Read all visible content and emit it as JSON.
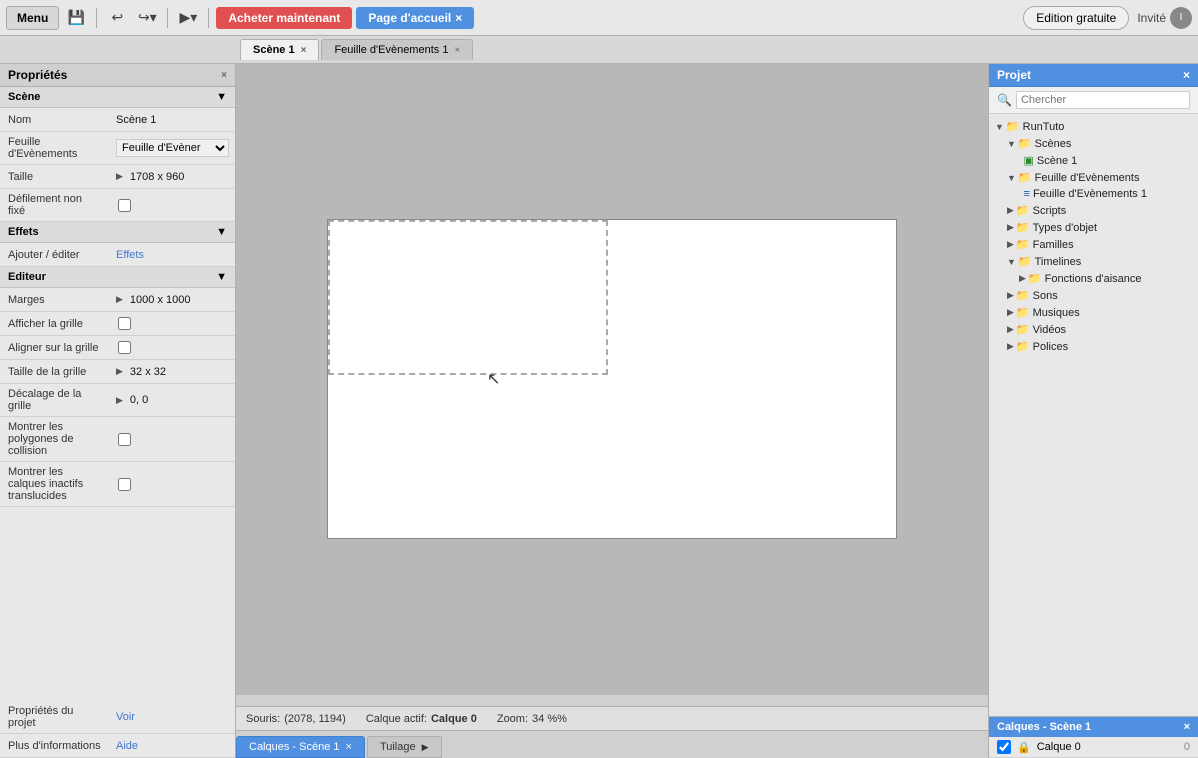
{
  "toolbar": {
    "menu_label": "Menu",
    "save_icon": "💾",
    "undo_icon": "↩",
    "redo_icon": "↪",
    "play_icon": "▶",
    "acheter_label": "Acheter maintenant",
    "accueil_label": "Page d'accueil",
    "accueil_close": "×",
    "edition_label": "Edition gratuite",
    "invite_label": "Invité",
    "avatar_label": "I"
  },
  "tabs": [
    {
      "label": "Scène 1",
      "active": true
    },
    {
      "label": "Feuille d'Evènements 1",
      "active": false
    }
  ],
  "properties": {
    "header": "Propriétés",
    "scene_section": "Scène",
    "rows": [
      {
        "label": "Nom",
        "value": "Scène 1",
        "type": "text"
      },
      {
        "label": "Feuille d'Evènements",
        "value": "Feuille d'Evèner",
        "type": "select"
      },
      {
        "label": "Taille",
        "value": "1708 x 960",
        "type": "arrow"
      },
      {
        "label": "Défilement non fixé",
        "value": "",
        "type": "checkbox"
      }
    ],
    "effects_section": "Effets",
    "effects_rows": [
      {
        "label": "Ajouter / éditer",
        "value": "Effets",
        "type": "link"
      }
    ],
    "editor_section": "Editeur",
    "editor_rows": [
      {
        "label": "Marges",
        "value": "1000 x 1000",
        "type": "arrow"
      },
      {
        "label": "Afficher la grille",
        "value": "",
        "type": "checkbox"
      },
      {
        "label": "Aligner sur la grille",
        "value": "",
        "type": "checkbox"
      },
      {
        "label": "Taille de la grille",
        "value": "32 x 32",
        "type": "arrow"
      },
      {
        "label": "Décalage de la grille",
        "value": "0, 0",
        "type": "arrow"
      },
      {
        "label": "Montrer les polygones de collision",
        "value": "",
        "type": "checkbox"
      },
      {
        "label": "Montrer les calques inactifs translucides",
        "value": "",
        "type": "checkbox"
      }
    ],
    "project_props": {
      "label": "Propriétés du projet",
      "value": "Voir",
      "type": "link"
    },
    "more_info": {
      "label": "Plus d'informations",
      "value": "Aide",
      "type": "link"
    }
  },
  "statusbar": {
    "souris_label": "Souris:",
    "souris_coords": "(2078, 1194)",
    "calque_label": "Calque actif:",
    "calque_value": "Calque 0",
    "zoom_label": "Zoom:",
    "zoom_value": "34 %%"
  },
  "bottom_tabs": [
    {
      "label": "Calques - Scène 1",
      "active": true,
      "close": "×"
    },
    {
      "label": "Tuilage",
      "active": false,
      "close": ""
    }
  ],
  "project": {
    "header": "Projet",
    "close": "×",
    "search_placeholder": "Chercher",
    "tree": [
      {
        "label": "RunTuto",
        "type": "folder",
        "level": 0,
        "expanded": true
      },
      {
        "label": "Scènes",
        "type": "folder",
        "level": 1,
        "expanded": true
      },
      {
        "label": "Scène 1",
        "type": "scene",
        "level": 2,
        "expanded": false
      },
      {
        "label": "Feuille d'Evènements",
        "type": "folder",
        "level": 1,
        "expanded": true
      },
      {
        "label": "Feuille d'Evènements 1",
        "type": "eventsheet",
        "level": 2,
        "expanded": false
      },
      {
        "label": "Scripts",
        "type": "folder",
        "level": 1,
        "expanded": false
      },
      {
        "label": "Types d'objet",
        "type": "folder",
        "level": 1,
        "expanded": false
      },
      {
        "label": "Familles",
        "type": "folder",
        "level": 1,
        "expanded": false
      },
      {
        "label": "Timelines",
        "type": "folder",
        "level": 1,
        "expanded": true
      },
      {
        "label": "Fonctions d'aisance",
        "type": "folder",
        "level": 2,
        "expanded": false
      },
      {
        "label": "Sons",
        "type": "folder",
        "level": 1,
        "expanded": false
      },
      {
        "label": "Musiques",
        "type": "folder",
        "level": 1,
        "expanded": false
      },
      {
        "label": "Vidéos",
        "type": "folder",
        "level": 1,
        "expanded": false
      },
      {
        "label": "Polices",
        "type": "folder",
        "level": 1,
        "expanded": false
      }
    ]
  },
  "calques": {
    "header": "Calques - Scène 1",
    "close": "×",
    "rows": [
      {
        "name": "Calque 0",
        "checked": true,
        "locked": true,
        "count": "0"
      }
    ]
  }
}
